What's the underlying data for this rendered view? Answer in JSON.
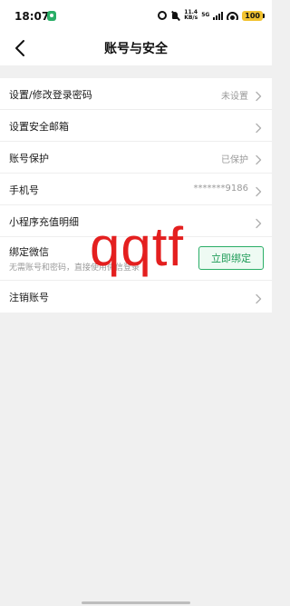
{
  "status_bar": {
    "time": "18:07",
    "net_speed_value": "11.4",
    "net_speed_unit": "KB/s",
    "network_type": "5G",
    "battery_level": "100",
    "icons": [
      "wechat-icon",
      "alarm-icon",
      "mute-icon",
      "signal-icon",
      "wifi-icon",
      "battery-icon"
    ]
  },
  "header": {
    "title": "账号与安全",
    "back_icon": "chevron-left-icon"
  },
  "settings": {
    "rows": [
      {
        "label": "设置/修改登录密码",
        "value": "未设置"
      },
      {
        "label": "设置安全邮箱",
        "value": ""
      },
      {
        "label": "账号保护",
        "value": "已保护"
      },
      {
        "label": "手机号",
        "value": "*******9186"
      },
      {
        "label": "小程序充值明细",
        "value": ""
      },
      {
        "label": "绑定微信",
        "sub": "无需账号和密码，直接使用微信登录",
        "button": "立即绑定"
      },
      {
        "label": "注销账号",
        "value": ""
      }
    ]
  },
  "overlay": {
    "text": "qqtf",
    "color": "#e41f1f"
  },
  "colors": {
    "accent_green": "#2aae67",
    "background": "#f0f0f0",
    "secondary_text": "#999999"
  }
}
